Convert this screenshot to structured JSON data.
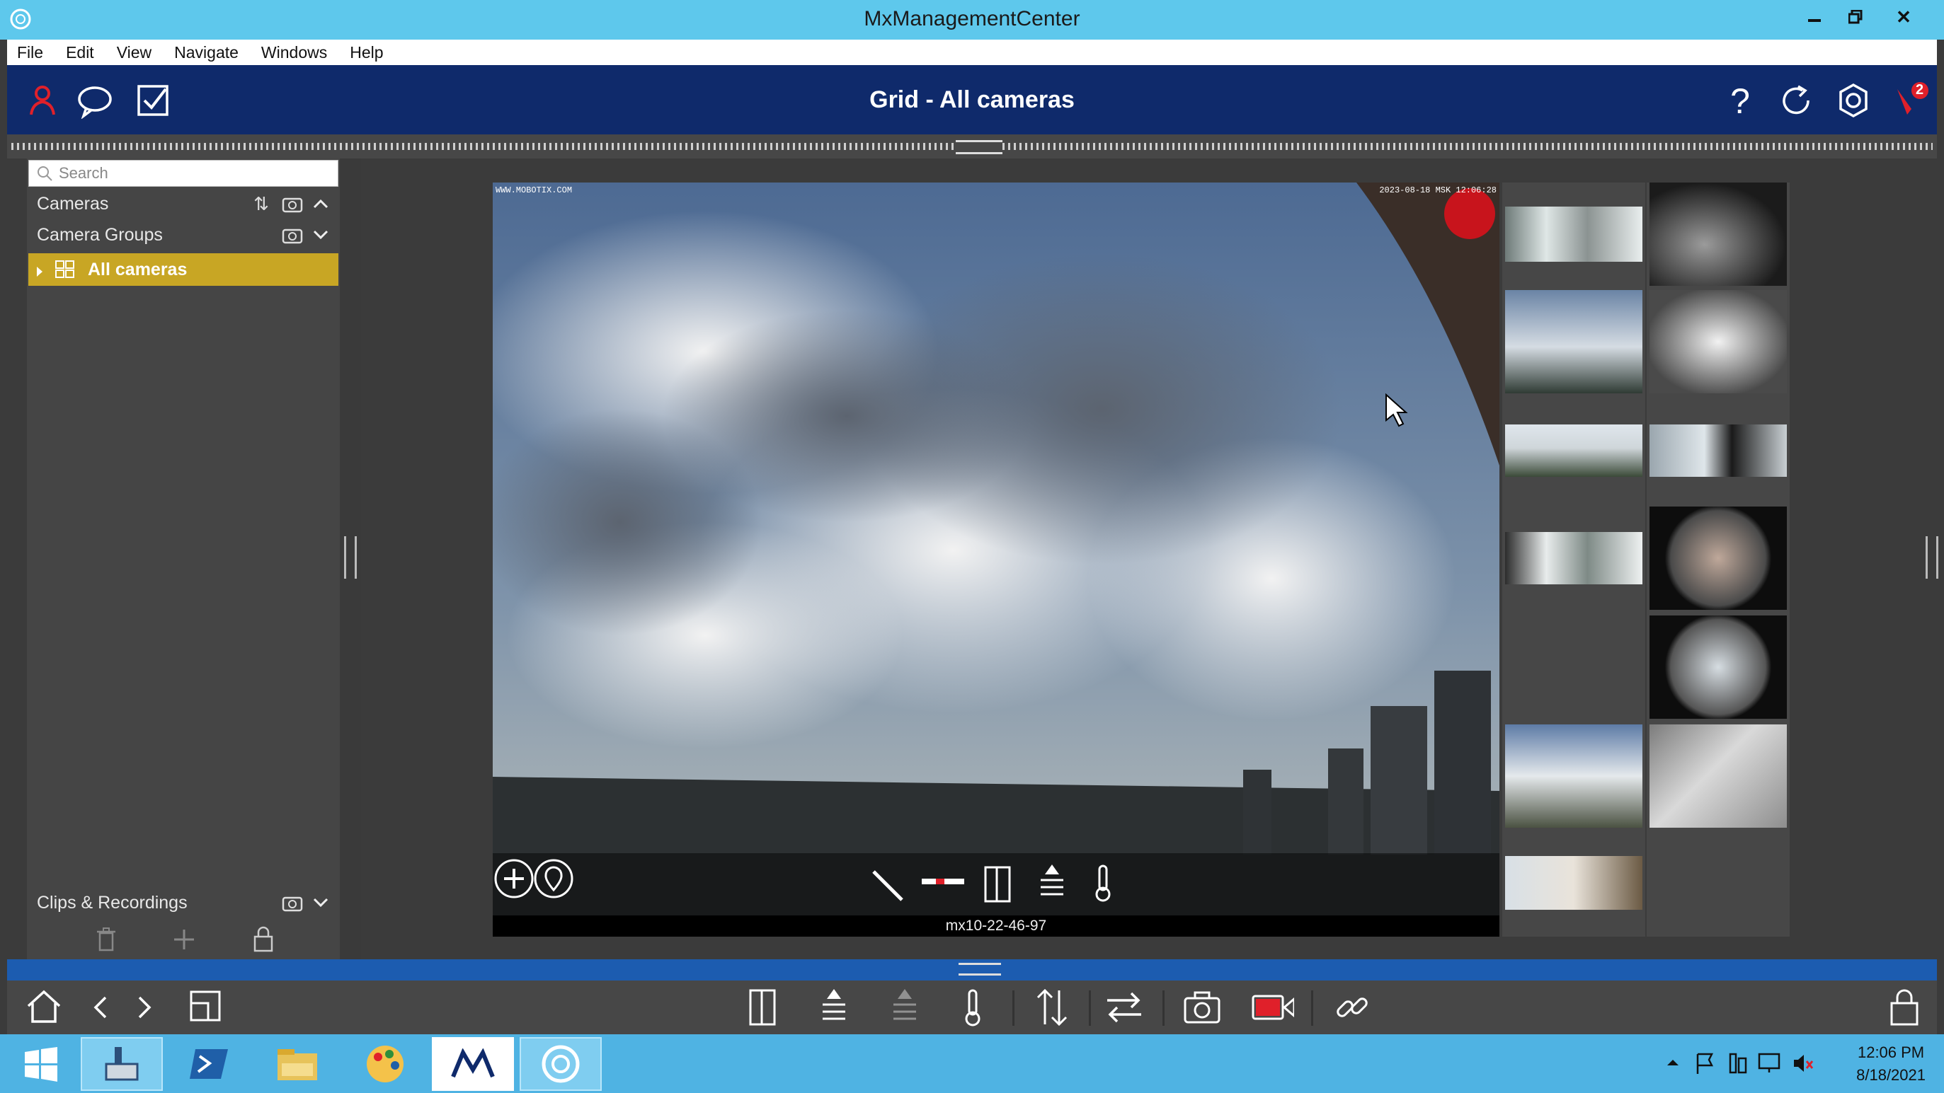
{
  "window": {
    "title": "MxManagementCenter",
    "buttons": [
      "minimize",
      "restore",
      "close"
    ]
  },
  "menu": [
    "File",
    "Edit",
    "View",
    "Navigate",
    "Windows",
    "Help"
  ],
  "header": {
    "title": "Grid - All cameras",
    "alarm_count": "2"
  },
  "sidebar": {
    "search_placeholder": "Search",
    "cameras_label": "Cameras",
    "camera_groups_label": "Camera Groups",
    "selected_group": "All cameras",
    "clips_label": "Clips & Recordings"
  },
  "main_camera": {
    "name": "mx10-22-46-97",
    "watermark_left": "WWW.MOBOTIX.COM",
    "watermark_right": "2023-08-18 MSK 12:06:28"
  },
  "taskbar": {
    "time": "12:06 PM",
    "date": "8/18/2021"
  },
  "colors": {
    "title_bar": "#5ec8ec",
    "app_header": "#0f2a6b",
    "selected_item": "#c8a624",
    "accent_red": "#e0202a",
    "blue_divider": "#1c5cb0"
  }
}
